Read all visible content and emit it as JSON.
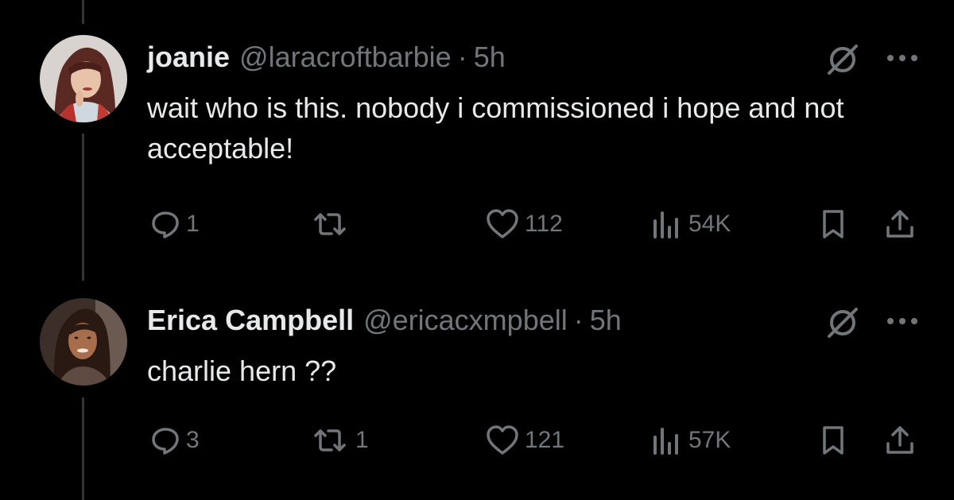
{
  "colors": {
    "background": "#000000",
    "primary_text": "#e7e9ea",
    "secondary_text": "#71767b",
    "thread_line": "#333639"
  },
  "tweets": [
    {
      "name": "joanie",
      "handle": "@laracroftbarbie",
      "separator": "·",
      "time": "5h",
      "text": "wait who is this. nobody i commissioned i hope and not acceptable!",
      "replies": "1",
      "reposts": "",
      "likes": "112",
      "views": "54K",
      "icons": [
        "reply-icon",
        "repost-icon",
        "like-icon",
        "views-icon",
        "bookmark-icon",
        "share-icon",
        "grok-icon",
        "more-icon"
      ]
    },
    {
      "name": "Erica Campbell",
      "handle": "@ericacxmpbell",
      "separator": "·",
      "time": "5h",
      "text": "charlie hern ??",
      "replies": "3",
      "reposts": "1",
      "likes": "121",
      "views": "57K",
      "icons": [
        "reply-icon",
        "repost-icon",
        "like-icon",
        "views-icon",
        "bookmark-icon",
        "share-icon",
        "grok-icon",
        "more-icon"
      ]
    }
  ]
}
